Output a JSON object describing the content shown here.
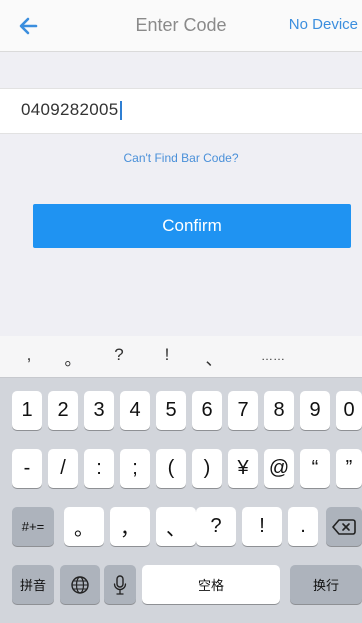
{
  "nav": {
    "title": "Enter Code",
    "right_label": "No Device"
  },
  "form": {
    "code_value": "0409282005",
    "link_text": "Can't Find Bar Code?",
    "confirm_label": "Confirm"
  },
  "keyboard": {
    "suggestions": [
      ",",
      "。",
      "?",
      "!",
      "、",
      "……"
    ],
    "row1": [
      "1",
      "2",
      "3",
      "4",
      "5",
      "6",
      "7",
      "8",
      "9",
      "0"
    ],
    "row2": [
      "-",
      "/",
      ":",
      ";",
      "(",
      ")",
      "¥",
      "@",
      "“",
      "”"
    ],
    "row3_mode": "#+=",
    "row3": [
      "。",
      "，",
      "、",
      "?",
      "!",
      "."
    ],
    "row4": {
      "pinyin": "拼音",
      "space": "空格",
      "return": "换行"
    }
  }
}
